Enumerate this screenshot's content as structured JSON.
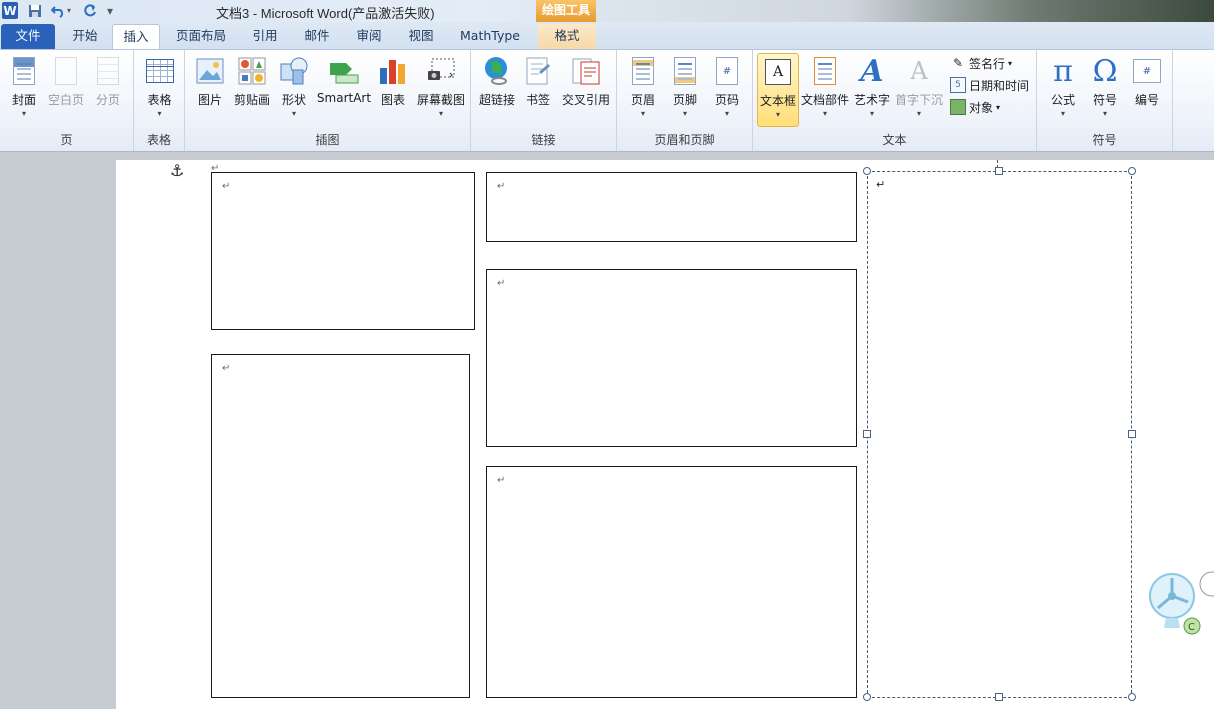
{
  "titlebar": {
    "app_logo": "W",
    "title": "文档3  -  Microsoft Word(产品激活失败)",
    "context_tool": "绘图工具",
    "qa_icons": [
      "save-icon",
      "undo-icon",
      "redo-icon",
      "customize-icon"
    ]
  },
  "tabs": {
    "file": "文件",
    "home": "开始",
    "insert": "插入",
    "layout": "页面布局",
    "references": "引用",
    "mailings": "邮件",
    "review": "审阅",
    "view": "视图",
    "mathtype": "MathType",
    "format": "格式"
  },
  "ribbon": {
    "pages": {
      "label": "页",
      "cover": "封面",
      "blank": "空白页",
      "break": "分页"
    },
    "tables": {
      "label": "表格",
      "table": "表格"
    },
    "illustrations": {
      "label": "插图",
      "picture": "图片",
      "clipart": "剪贴画",
      "shapes": "形状",
      "smartart": "SmartArt",
      "chart": "图表",
      "screenshot": "屏幕截图"
    },
    "links": {
      "label": "链接",
      "hyperlink": "超链接",
      "bookmark": "书签",
      "crossref": "交叉引用"
    },
    "headerfooter": {
      "label": "页眉和页脚",
      "header": "页眉",
      "footer": "页脚",
      "pagenum": "页码"
    },
    "text": {
      "label": "文本",
      "textbox": "文本框",
      "quickparts": "文档部件",
      "wordart": "艺术字",
      "dropcap": "首字下沉",
      "signature": "签名行",
      "datetime": "日期和时间",
      "object": "对象"
    },
    "symbols": {
      "label": "符号",
      "equation": "公式",
      "symbol": "符号",
      "number": "编号",
      "pi": "π",
      "omega": "Ω"
    }
  },
  "document": {
    "para_mark": "↵",
    "anchor_symbol": "⚓"
  },
  "colors": {
    "file_tab": "#2a62b9",
    "context_tool": "#e89a2c",
    "pressed_button": "#ffdf7a"
  }
}
